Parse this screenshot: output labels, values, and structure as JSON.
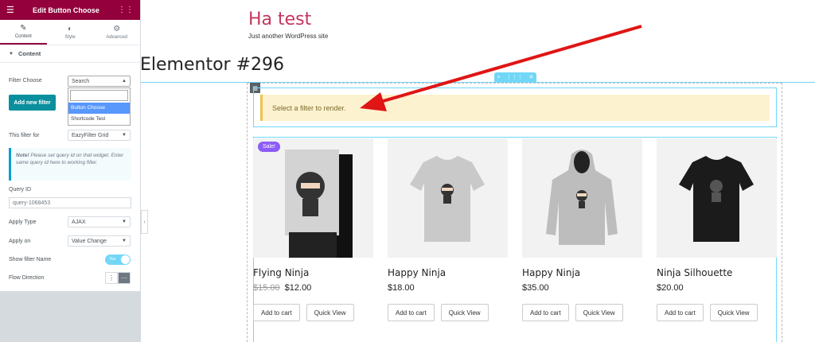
{
  "panel": {
    "title": "Edit Button Choose",
    "tabs": [
      {
        "label": "Content",
        "icon": "pencil-icon"
      },
      {
        "label": "Style",
        "icon": "contrast-icon"
      },
      {
        "label": "Advanced",
        "icon": "gear-icon"
      }
    ],
    "section": "Content",
    "filter_choose_label": "Filter Choose",
    "filter_choose_value": "Search",
    "dropdown_options": [
      "Button Choose",
      "Shortcode Test"
    ],
    "add_button": "Add new filter",
    "this_filter_label": "This filter for",
    "this_filter_value": "EazyFilter Grid",
    "note_bold": "Note!",
    "note_text": " Please set query id on that widget. Enter same query id here to working filter.",
    "query_label": "Query ID",
    "query_value": "query-1068453",
    "apply_type_label": "Apply Type",
    "apply_type_value": "AJAX",
    "apply_on_label": "Apply on",
    "apply_on_value": "Value Change",
    "show_name_label": "Show filter Name",
    "show_name_toggle": "Yes",
    "flow_label": "Flow Direction"
  },
  "site": {
    "title": "Ha test",
    "tagline": "Just another WordPress site"
  },
  "page_title": "Elementor #296",
  "notice": "Select a filter to render.",
  "products": [
    {
      "name": "Flying Ninja",
      "old_price": "$15.00",
      "price": "$12.00",
      "badge": "Sale!"
    },
    {
      "name": "Happy Ninja",
      "price": "$18.00"
    },
    {
      "name": "Happy Ninja",
      "price": "$35.00"
    },
    {
      "name": "Ninja Silhouette",
      "price": "$20.00"
    }
  ],
  "buttons": {
    "cart": "Add to cart",
    "quick": "Quick View"
  },
  "colors": {
    "brand": "#93003c",
    "accent": "#71d7f7",
    "arrow": "#e01515"
  }
}
